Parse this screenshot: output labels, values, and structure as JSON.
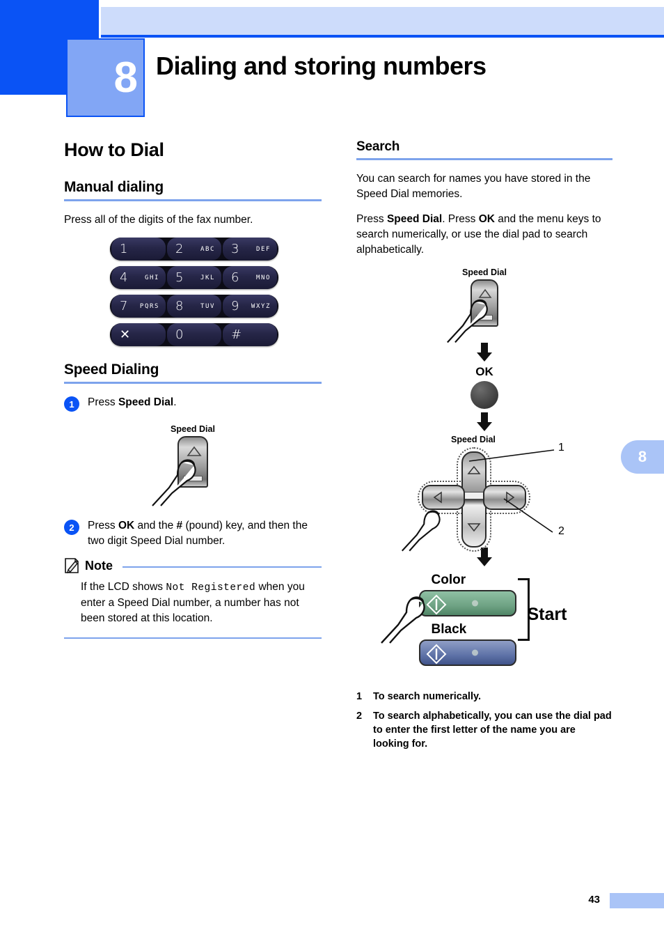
{
  "header": {
    "chapter_number": "8",
    "chapter_title": "Dialing and storing numbers"
  },
  "left_column": {
    "section_title": "How to Dial",
    "manual": {
      "heading": "Manual dialing",
      "body": "Press all of the digits of the fax number.",
      "keypad": [
        [
          {
            "digit": "1",
            "letters": ""
          },
          {
            "digit": "2",
            "letters": "ABC"
          },
          {
            "digit": "3",
            "letters": "DEF"
          }
        ],
        [
          {
            "digit": "4",
            "letters": "GHI"
          },
          {
            "digit": "5",
            "letters": "JKL"
          },
          {
            "digit": "6",
            "letters": "MNO"
          }
        ],
        [
          {
            "digit": "7",
            "letters": "PQRS"
          },
          {
            "digit": "8",
            "letters": "TUV"
          },
          {
            "digit": "9",
            "letters": "WXYZ"
          }
        ],
        [
          {
            "digit": "✕",
            "letters": ""
          },
          {
            "digit": "0",
            "letters": ""
          },
          {
            "digit": "#",
            "letters": ""
          }
        ]
      ]
    },
    "speed_dialing": {
      "heading": "Speed Dialing",
      "step1": {
        "number": "1",
        "text_prefix": "Press ",
        "text_bold": "Speed Dial",
        "text_suffix": "."
      },
      "speed_dial_label": "Speed Dial",
      "step2": {
        "number": "2",
        "part1": "Press ",
        "bold1": "OK",
        "part2": " and the ",
        "bold2": "#",
        "part3": " (pound) key, and then the two digit Speed Dial number."
      },
      "note": {
        "title": "Note",
        "part1": "If the LCD shows ",
        "mono": "Not Registered",
        "part2": " when you enter a Speed Dial number, a number has not been stored at this location."
      }
    }
  },
  "right_column": {
    "search": {
      "heading": "Search",
      "paragraph1": "You can search for names you have stored in the Speed Dial memories.",
      "p2_part1": "Press ",
      "p2_bold1": "Speed Dial",
      "p2_part2": ". Press ",
      "p2_bold2": "OK",
      "p2_part3": " and the menu keys to search numerically, or use the dial pad to search alphabetically."
    },
    "diagram": {
      "speed_dial_label": "Speed Dial",
      "ok_label": "OK",
      "nav_label": "Speed Dial",
      "callout_1": "1",
      "callout_2": "2",
      "color_label": "Color",
      "black_label": "Black",
      "start_label": "Start"
    },
    "footnotes": [
      {
        "number": "1",
        "text": "To search numerically."
      },
      {
        "number": "2",
        "text": "To search alphabetically, you can use the dial pad to enter the first letter of the name you are looking for."
      }
    ]
  },
  "page_furniture": {
    "side_tab": "8",
    "page_number": "43"
  },
  "colors": {
    "brand_blue": "#0a53f5",
    "band_light": "#cddcfb",
    "chapter_box": "#82a6f5",
    "rule_blue": "#7da3ec",
    "tab_blue": "#aac4f7",
    "color_button": "#6fa384",
    "black_button": "#5f73a8"
  }
}
